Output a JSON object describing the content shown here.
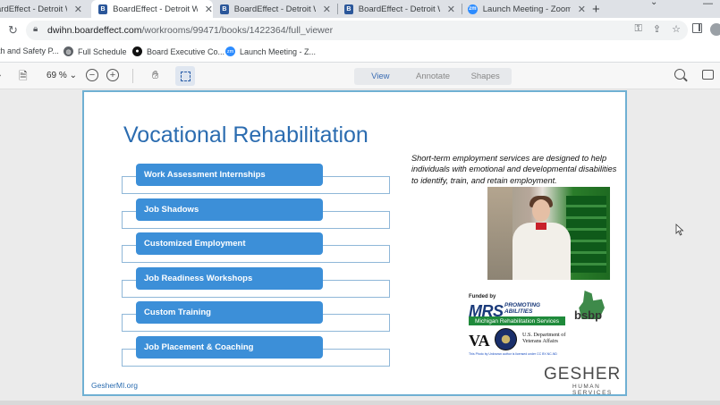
{
  "browser": {
    "tabs": [
      {
        "label": "ardEffect - Detroit Wa",
        "icon": "boardeffect-icon",
        "active": false
      },
      {
        "label": "BoardEffect - Detroit Wa",
        "icon": "boardeffect-icon",
        "active": true
      },
      {
        "label": "BoardEffect - Detroit Wa",
        "icon": "boardeffect-icon",
        "active": false
      },
      {
        "label": "BoardEffect - Detroit Wa",
        "icon": "boardeffect-icon",
        "active": false
      },
      {
        "label": "Launch Meeting - Zoom",
        "icon": "zoom-icon",
        "active": false
      }
    ],
    "url_host": "dwihn.boardeffect.com",
    "url_path": "/workrooms/99471/books/1422364/full_viewer",
    "bookmarks": [
      {
        "label": "th and Safety P..."
      },
      {
        "label": "Full Schedule",
        "icon": "globe-icon"
      },
      {
        "label": "Board Executive Co...",
        "icon": "dark-circle-icon"
      },
      {
        "label": "Launch Meeting - Z...",
        "icon": "zoom-icon"
      }
    ]
  },
  "viewer": {
    "zoom": "69 %",
    "modes": [
      "View",
      "Annotate",
      "Shapes"
    ],
    "active_mode": "View"
  },
  "slide": {
    "title": "Vocational Rehabilitation",
    "items": [
      "Work Assessment Internships",
      "Job Shadows",
      "Customized Employment",
      "Job Readiness Workshops",
      "Custom Training",
      "Job Placement & Coaching"
    ],
    "description": "Short-term employment services are designed to help individuals with emotional and developmental disabilities to identify, train, and retain employment.",
    "funded_by": "Funded by",
    "mrs_logo": "MRS",
    "mrs_tagline": "PROMOTING ABILITIES",
    "mrs_bar": "Michigan Rehabilitation Services",
    "bsbp": "bsbp",
    "va_logo": "VA",
    "va_dept": "U.S. Department of Veterans Affairs",
    "credit_line": "This Photo by Unknown author is licensed under CC BY-NC-ND",
    "gesher": "GESHER",
    "gesher_sub": "HUMAN SERVICES",
    "site": "GesherMI.org"
  }
}
